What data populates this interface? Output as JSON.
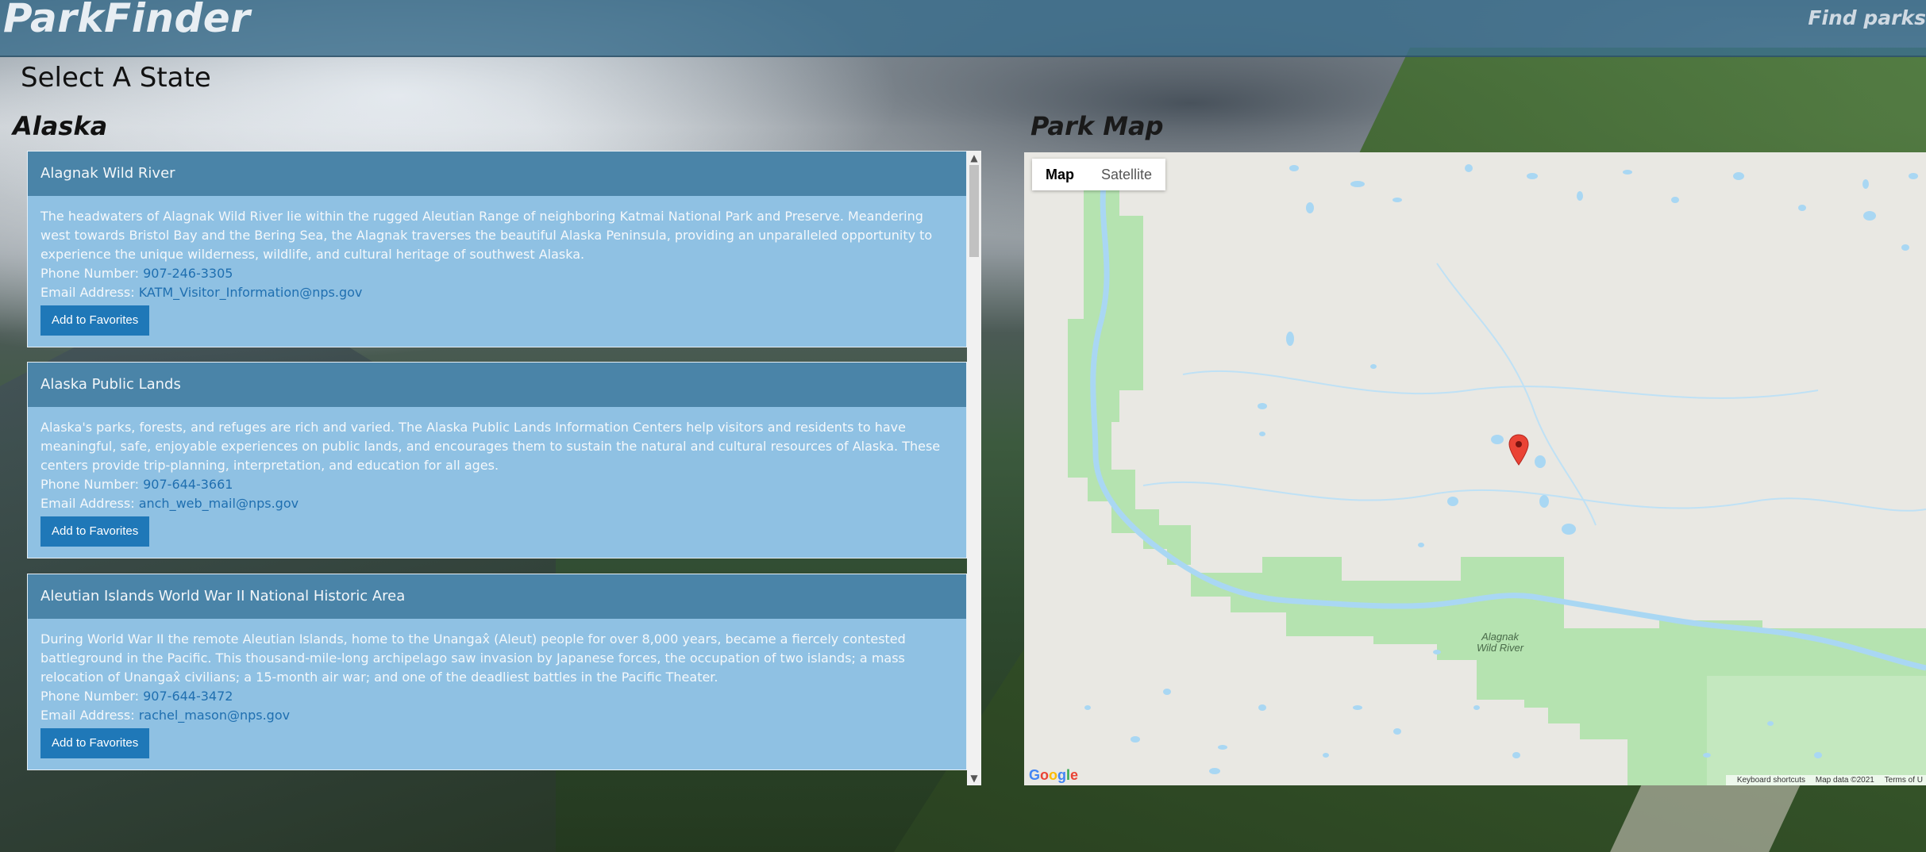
{
  "header": {
    "brand": "ParkFinder",
    "find_link": "Find parks"
  },
  "page": {
    "select_label": "Select A State",
    "state_name": "Alaska",
    "map_title": "Park Map"
  },
  "parks": [
    {
      "name": "Alagnak Wild River",
      "description": "The headwaters of Alagnak Wild River lie within the rugged Aleutian Range of neighboring Katmai National Park and Preserve. Meandering west towards Bristol Bay and the Bering Sea, the Alagnak traverses the beautiful Alaska Peninsula, providing an unparalleled opportunity to experience the unique wilderness, wildlife, and cultural heritage of southwest Alaska.",
      "phone_label": "Phone Number:",
      "phone": "907-246-3305",
      "email_label": "Email Address:",
      "email": "KATM_Visitor_Information@nps.gov",
      "button": "Add to Favorites"
    },
    {
      "name": "Alaska Public Lands",
      "description": "Alaska's parks, forests, and refuges are rich and varied. The Alaska Public Lands Information Centers help visitors and residents to have meaningful, safe, enjoyable experiences on public lands, and encourages them to sustain the natural and cultural resources of Alaska. These centers provide trip-planning, interpretation, and education for all ages.",
      "phone_label": "Phone Number:",
      "phone": "907-644-3661",
      "email_label": "Email Address:",
      "email": "anch_web_mail@nps.gov",
      "button": "Add to Favorites"
    },
    {
      "name": "Aleutian Islands World War II National Historic Area",
      "description": "During World War II the remote Aleutian Islands, home to the Unangax̂ (Aleut) people for over 8,000 years, became a fiercely contested battleground in the Pacific. This thousand-mile-long archipelago saw invasion by Japanese forces, the occupation of two islands; a mass relocation of Unangax̂ civilians; a 15-month air war; and one of the deadliest battles in the Pacific Theater.",
      "phone_label": "Phone Number:",
      "phone": "907-644-3472",
      "email_label": "Email Address:",
      "email": "rachel_mason@nps.gov",
      "button": "Add to Favorites"
    }
  ],
  "map": {
    "tab_map": "Map",
    "tab_satellite": "Satellite",
    "place_label_line1": "Alagnak",
    "place_label_line2": "Wild River",
    "logo": "Google",
    "keyboard": "Keyboard shortcuts",
    "map_data": "Map data ©2021",
    "terms": "Terms of U",
    "marker_icon": "map-pin-icon",
    "marker_color": "#ea4335",
    "park_color": "#b5e3b0",
    "water_color": "#a9d7f3"
  }
}
